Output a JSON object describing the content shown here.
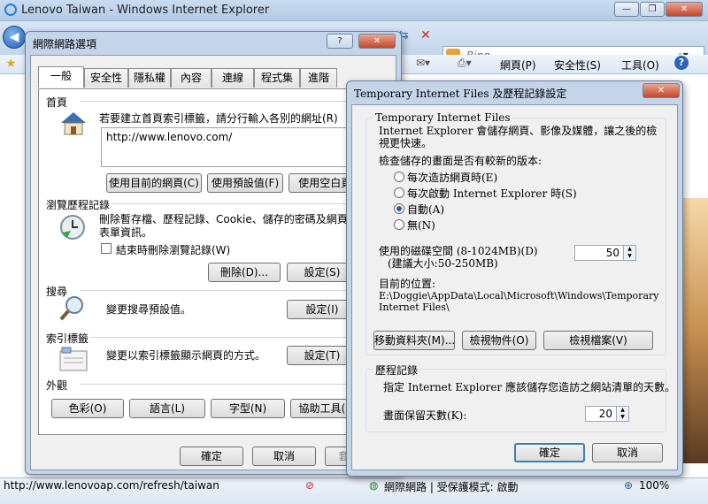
{
  "browser": {
    "title": "Lenovo Taiwan - Windows Internet Explorer",
    "search_placeholder": "Bing",
    "menus": [
      "網頁(P)",
      "安全性(S)",
      "工具(O)"
    ],
    "status_url": "http://www.lenovoap.com/refresh/taiwan",
    "zone_text": "網際網路 | 受保護模式: 啟動",
    "zoom": "100%"
  },
  "options_dialog": {
    "title": "網際網路選項",
    "help": "?",
    "tabs": [
      "一般",
      "安全性",
      "隱私權",
      "內容",
      "連線",
      "程式集",
      "進階"
    ],
    "home": {
      "title": "首頁",
      "desc": "若要建立首頁索引標籤，請分行輸入各別的網址(R)",
      "url": "http://www.lenovo.com/",
      "btn_current": "使用目前的網頁(C)",
      "btn_default": "使用預設值(F)",
      "btn_blank": "使用空白頁(B)"
    },
    "history": {
      "title": "瀏覽歷程記錄",
      "desc": "刪除暫存檔、歷程記錄、Cookie、儲存的密碼及網頁表單資訊。",
      "checkbox": "結束時刪除瀏覽記錄(W)",
      "btn_delete": "刪除(D)...",
      "btn_settings": "設定(S)"
    },
    "search": {
      "title": "搜尋",
      "desc": "變更搜尋預設值。",
      "btn_settings": "設定(I)"
    },
    "tabsec": {
      "title": "索引標籤",
      "desc": "變更以索引標籤顯示網頁的方式。",
      "btn_settings": "設定(T)"
    },
    "appearance": {
      "title": "外觀",
      "buttons": [
        "色彩(O)",
        "語言(L)",
        "字型(N)",
        "協助工具(E)"
      ]
    },
    "btn_ok": "確定",
    "btn_cancel": "取消",
    "btn_apply": "套用(A)"
  },
  "tif_dialog": {
    "title": "Temporary Internet Files 及歷程記錄設定",
    "tif_group": "Temporary Internet Files",
    "tif_desc": "Internet Explorer 會儲存網頁、影像及媒體，讓之後的檢視更快速。",
    "check_prompt": "檢查儲存的畫面是否有較新的版本:",
    "radios": [
      "每次造訪網頁時(E)",
      "每次啟動 Internet Explorer 時(S)",
      "自動(A)",
      "無(N)"
    ],
    "selected_radio": 2,
    "disk_label": "使用的磁碟空間 (8-1024MB)(D)",
    "disk_hint": "(建議大小:50-250MB)",
    "disk_value": "50",
    "location_label": "目前的位置:",
    "location_path": "E:\\Doggie\\AppData\\Local\\Microsoft\\Windows\\Temporary Internet Files\\",
    "btn_move": "移動資料夾(M)...",
    "btn_objects": "檢視物件(O)",
    "btn_files": "檢視檔案(V)",
    "history_group": "歷程記錄",
    "history_desc": "指定 Internet Explorer 應該儲存您造訪之網站清單的天數。",
    "days_label": "畫面保留天數(K):",
    "days_value": "20",
    "btn_ok": "確定",
    "btn_cancel": "取消"
  }
}
